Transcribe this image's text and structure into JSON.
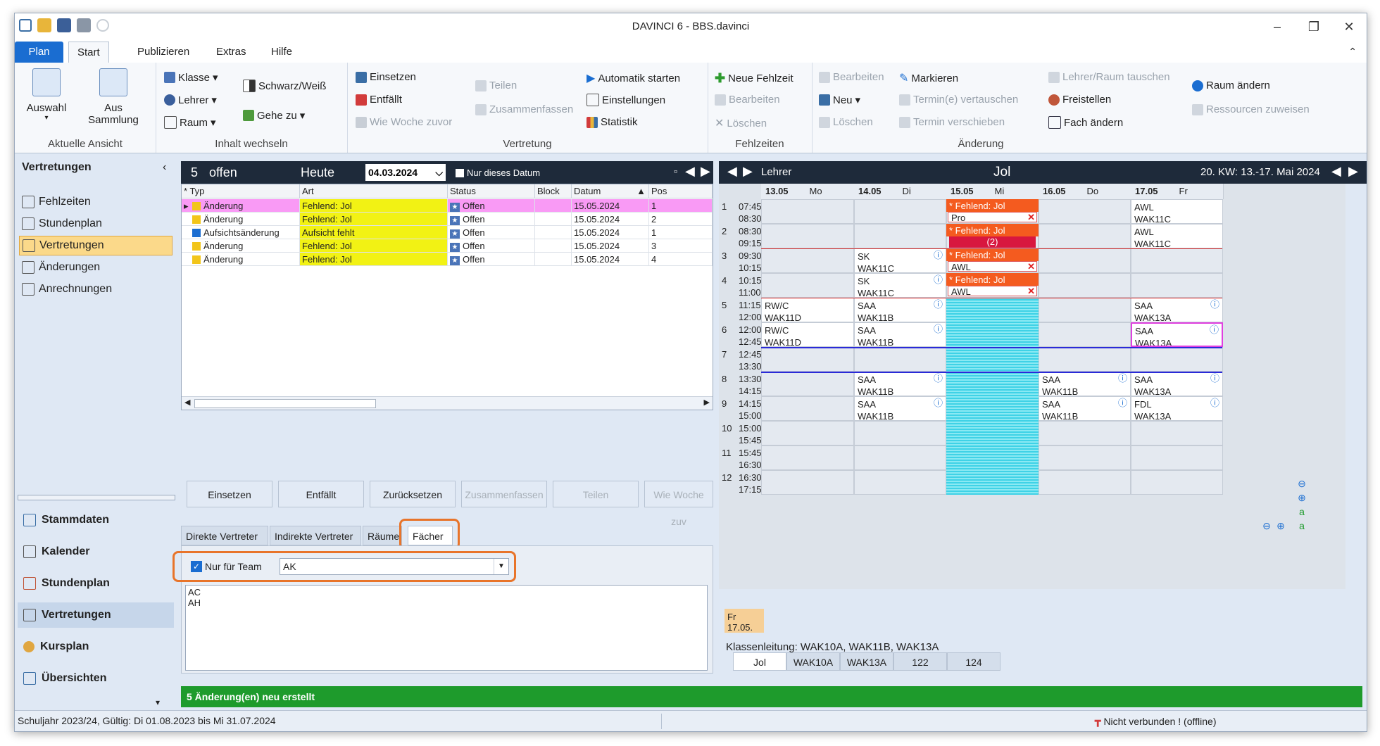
{
  "window": {
    "title": "DAVINCI 6 - BBS.davinci"
  },
  "tabs": [
    "Plan",
    "Start",
    "Publizieren",
    "Extras",
    "Hilfe"
  ],
  "ribbon": {
    "ansicht": {
      "auswahl": "Auswahl",
      "aus": "Aus",
      "sammlung": "Sammlung",
      "label": "Aktuelle Ansicht"
    },
    "inhalt": {
      "klasse": "Klasse",
      "lehrer": "Lehrer",
      "raum": "Raum",
      "schwarz": "Schwarz/Weiß",
      "gehe": "Gehe zu",
      "label": "Inhalt wechseln"
    },
    "vertretung": {
      "einsetzen": "Einsetzen",
      "entfaellt": "Entfällt",
      "wie": "Wie Woche zuvor",
      "teilen": "Teilen",
      "zusammen": "Zusammenfassen",
      "auto": "Automatik starten",
      "einst": "Einstellungen",
      "stat": "Statistik",
      "label": "Vertretung"
    },
    "fehlzeiten": {
      "neu": "Neue Fehlzeit",
      "bearb": "Bearbeiten",
      "loeschen": "Löschen",
      "label": "Fehlzeiten"
    },
    "aenderung": {
      "bearb": "Bearbeiten",
      "neu": "Neu",
      "loeschen": "Löschen",
      "markieren": "Markieren",
      "vertauschen": "Termin(e) vertauschen",
      "verschieben": "Termin verschieben",
      "tauschen": "Lehrer/Raum tauschen",
      "freistellen": "Freistellen",
      "fach": "Fach ändern",
      "raum": "Raum ändern",
      "ress": "Ressourcen zuweisen",
      "label": "Änderung"
    }
  },
  "nav": {
    "heading": "Vertretungen",
    "items": [
      "Fehlzeiten",
      "Stundenplan",
      "Vertretungen",
      "Änderungen",
      "Anrechnungen"
    ],
    "bottom": [
      "Stammdaten",
      "Kalender",
      "Stundenplan",
      "Vertretungen",
      "Kursplan",
      "Übersichten"
    ]
  },
  "center": {
    "count": "5",
    "offen": "offen",
    "heute": "Heute",
    "date": "04.03.2024",
    "only_date": "Nur dieses Datum",
    "columns": [
      "Typ",
      "Art",
      "Status",
      "Block",
      "Datum",
      "Pos"
    ],
    "rows": [
      {
        "typ": "Änderung",
        "art": "Fehlend: Jol",
        "status": "Offen",
        "datum": "15.05.2024",
        "pos": "1"
      },
      {
        "typ": "Änderung",
        "art": "Fehlend: Jol",
        "status": "Offen",
        "datum": "15.05.2024",
        "pos": "2"
      },
      {
        "typ": "Aufsichtsänderung",
        "art": "Aufsicht fehlt",
        "status": "Offen",
        "datum": "15.05.2024",
        "pos": "1"
      },
      {
        "typ": "Änderung",
        "art": "Fehlend: Jol",
        "status": "Offen",
        "datum": "15.05.2024",
        "pos": "3"
      },
      {
        "typ": "Änderung",
        "art": "Fehlend: Jol",
        "status": "Offen",
        "datum": "15.05.2024",
        "pos": "4"
      }
    ],
    "buttons": [
      "Einsetzen",
      "Entfällt",
      "Zurücksetzen",
      "Zusammenfassen",
      "Teilen",
      "Wie Woche zuv"
    ],
    "subtabs": [
      "Direkte Vertreter",
      "Indirekte Vertreter",
      "Räume",
      "Fächer"
    ],
    "team_label": "Nur für Team",
    "team_value": "AK",
    "list": [
      "AC",
      "AH"
    ]
  },
  "right": {
    "lehrer": "Lehrer",
    "name": "Jol",
    "week": "20. KW: 13.-17. Mai 2024",
    "days": [
      {
        "date": "13.05",
        "wd": "Mo"
      },
      {
        "date": "14.05",
        "wd": "Di"
      },
      {
        "date": "15.05",
        "wd": "Mi"
      },
      {
        "date": "16.05",
        "wd": "Do"
      },
      {
        "date": "17.05",
        "wd": "Fr"
      }
    ],
    "periods": [
      {
        "n": "1",
        "a": "07:45",
        "b": "08:30"
      },
      {
        "n": "2",
        "a": "08:30",
        "b": "09:15"
      },
      {
        "n": "3",
        "a": "09:30",
        "b": "10:15"
      },
      {
        "n": "4",
        "a": "10:15",
        "b": "11:00"
      },
      {
        "n": "5",
        "a": "11:15",
        "b": "12:00"
      },
      {
        "n": "6",
        "a": "12:00",
        "b": "12:45"
      },
      {
        "n": "7",
        "a": "12:45",
        "b": "13:30"
      },
      {
        "n": "8",
        "a": "13:30",
        "b": "14:15"
      },
      {
        "n": "9",
        "a": "14:15",
        "b": "15:00"
      },
      {
        "n": "10",
        "a": "15:00",
        "b": "15:45"
      },
      {
        "n": "11",
        "a": "15:45",
        "b": "16:30"
      },
      {
        "n": "12",
        "a": "16:30",
        "b": "17:15"
      }
    ],
    "absent_label": "* Fehlend: Jol",
    "sub_pro": "Pro",
    "sub_awl": "AWL",
    "sub_count": "(2)",
    "c_awl": "AWL",
    "c_wak11c": "WAK11C",
    "c_sk": "SK",
    "c_rwc": "RW/C",
    "c_wak11d": "WAK11D",
    "c_saa": "SAA",
    "c_wak11b": "WAK11B",
    "c_wak13a": "WAK13A",
    "c_fdl": "FDL",
    "footer_day": "Fr 17.05.",
    "klassenleitung": "Klassenleitung: WAK10A, WAK11B, WAK13A",
    "bottom_tabs": [
      "Jol",
      "WAK10A",
      "WAK13A",
      "122",
      "124"
    ]
  },
  "status": {
    "msg": "5 Änderung(en) neu erstellt",
    "left": "Schuljahr 2023/24, Gültig: Di 01.08.2023 bis Mi 31.07.2024",
    "right": "Nicht verbunden ! (offline)"
  },
  "colors": {
    "accent": "#1a6dd1",
    "highlight": "#e8742a",
    "absent": "#f45b1f",
    "green": "#1e9b2c",
    "yellow": "#f2f214",
    "pink": "#f99af5"
  }
}
